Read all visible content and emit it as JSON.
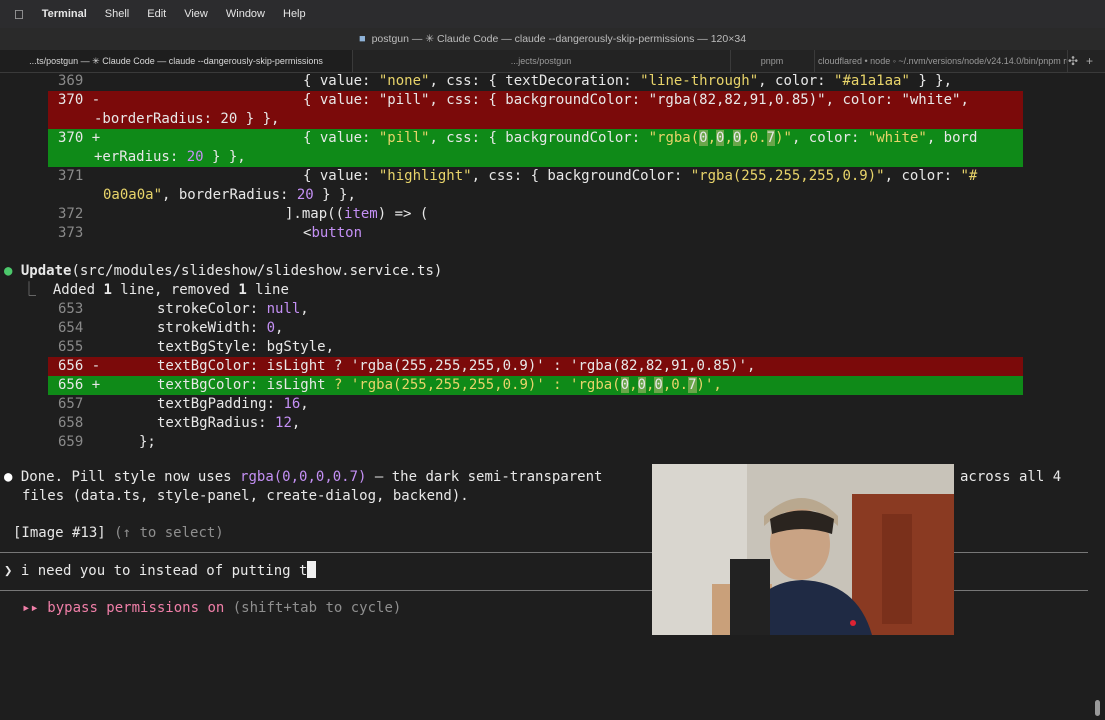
{
  "menubar": {
    "apple_icon": "apple-icon",
    "app": "Terminal",
    "items": [
      "Shell",
      "Edit",
      "View",
      "Window",
      "Help"
    ]
  },
  "window": {
    "title": "postgun — ✳ Claude Code — claude --dangerously-skip-permissions — 120×34"
  },
  "tabs": [
    {
      "label": "...ts/postgun — ✳ Claude Code — claude --dangerously-skip-permissions",
      "active": false
    },
    {
      "label": "...jects/postgun",
      "active": false
    },
    {
      "label": "pnpm",
      "active": false
    },
    {
      "label": "cloudflared • node ◦ ~/.nvm/versions/node/v24.14.0/bin/pnpm run dev",
      "active": false
    }
  ],
  "terminal": {
    "diff1": [
      {
        "n": "369",
        "sign": "",
        "kind": "ctx",
        "parts": [
          "{ value: ",
          "\"none\"",
          ", css: { textDecoration: ",
          "\"line-through\"",
          ", color: ",
          "\"#a1a1aa\"",
          " } },"
        ]
      },
      {
        "n": "370",
        "sign": "-",
        "kind": "del",
        "text1": "{ value: \"pill\", css: { backgroundColor: \"rgba(82,82,91,0.85)\", color: \"white\",",
        "text2": "-borderRadius: 20 } },"
      },
      {
        "n": "370",
        "sign": "+",
        "kind": "add",
        "text1a": "{ value: ",
        "text1b": "\"pill\"",
        "text1c": ", css: { backgroundColor: ",
        "text1d": "\"rgba(",
        "hl1": "0",
        "c1": ",",
        "hl2": "0",
        "c2": ",",
        "hl3": "0",
        "c3": ",0.",
        "hl4": "7",
        "text1e": ")\"",
        "text1f": ", color: ",
        "text1g": "\"white\"",
        "text1h": ", bord",
        "text2a": "+erRadius: ",
        "text2b": "20",
        "text2c": " } },"
      },
      {
        "n": "371",
        "sign": "",
        "kind": "ctx",
        "text1a": "{ value: ",
        "text1b": "\"highlight\"",
        "text1c": ", css: { backgroundColor: ",
        "text1d": "\"rgba(255,255,255,0.9)\"",
        "text1e": ", color: ",
        "text1f": "\"#",
        "text2a": "0a0a0a\"",
        "text2b": ", borderRadius: ",
        "text2c": "20",
        "text2d": " } },"
      },
      {
        "n": "372",
        "text": "].map((",
        "kw": "item",
        "text2": ") => ("
      },
      {
        "n": "373",
        "text": "<",
        "kw": "button"
      }
    ],
    "update": {
      "label": "Update",
      "path": "(src/modules/slideshow/slideshow.service.ts)",
      "summary_a": "Added ",
      "summary_b": "1",
      "summary_c": " line, removed ",
      "summary_d": "1",
      "summary_e": " line"
    },
    "diff2": [
      {
        "n": "653",
        "a": "strokeColor: ",
        "b": "null",
        "c": ","
      },
      {
        "n": "654",
        "a": "strokeWidth: ",
        "b": "0",
        "c": ","
      },
      {
        "n": "655",
        "a": "textBgStyle: bgStyle,"
      },
      {
        "n": "656",
        "sign": "-",
        "text": "textBgColor: isLight ? 'rgba(255,255,255,0.9)' : 'rgba(82,82,91,0.85)',"
      },
      {
        "n": "656",
        "sign": "+",
        "a": "textBgColor: isLight ",
        "q": "?",
        "s1": " 'rgba(255,255,255,0.9)' ",
        "colon": ":",
        "s2": " 'rgba(",
        "h1": "0",
        "k1": ",",
        "h2": "0",
        "k2": ",",
        "h3": "0",
        "k3": ",0.",
        "h4": "7",
        "s3": ")',"
      },
      {
        "n": "657",
        "a": "textBgPadding: ",
        "b": "16",
        "c": ","
      },
      {
        "n": "658",
        "a": "textBgRadius: ",
        "b": "12",
        "c": ","
      },
      {
        "n": "659",
        "a": "};"
      }
    ],
    "done": {
      "line1a": "Done. Pill style now uses ",
      "line1b": "rgba(0,0,0,0.7)",
      "line1c": " — the dark semi-transparent",
      "line1d": "across all 4",
      "line2": "files (data.ts, style-panel, create-dialog, backend)."
    },
    "image_ref": "[Image #13]",
    "image_hint": "(↑ to select)",
    "prompt_symbol": "❯",
    "prompt_text": "i need you to instead of putting t",
    "bypass_icon": "▸▸",
    "bypass_text": "bypass permissions on",
    "bypass_hint": "(shift+tab to cycle)"
  }
}
